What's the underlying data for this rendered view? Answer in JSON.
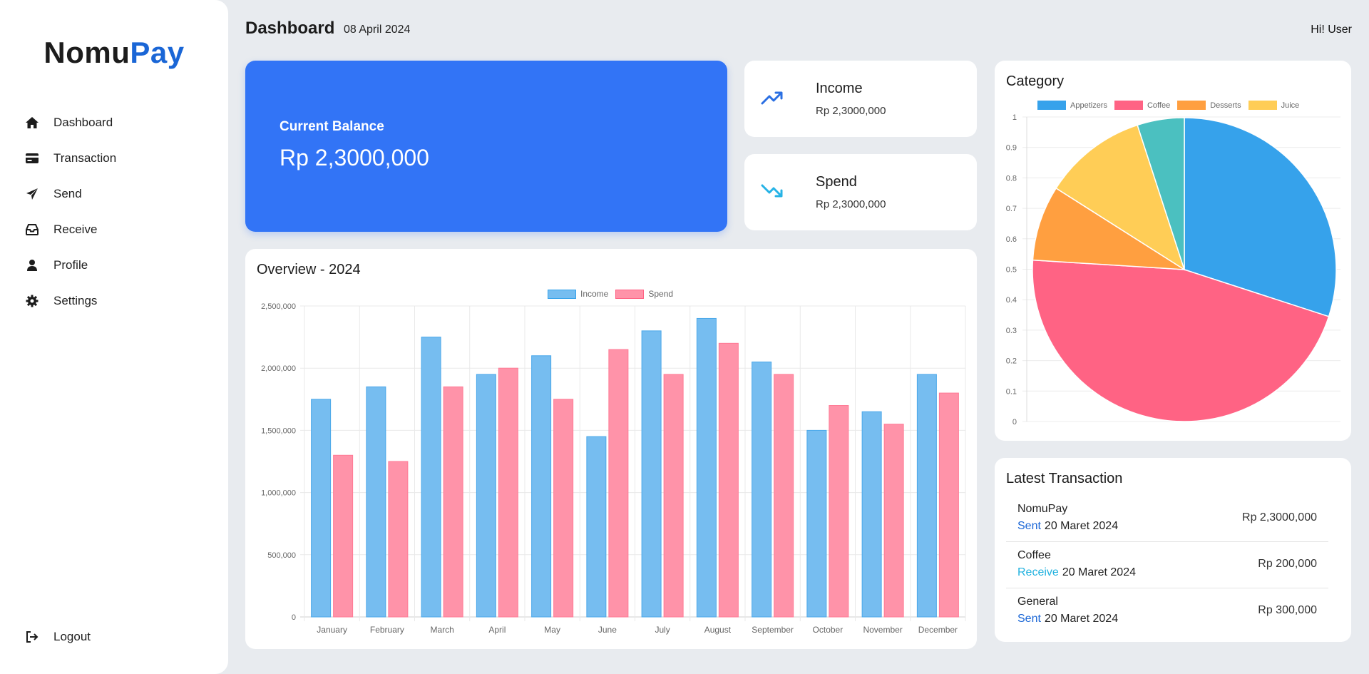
{
  "sidebar": {
    "brand_a": "Nomu",
    "brand_b": "Pay",
    "items": [
      {
        "label": "Dashboard",
        "icon": "home-icon"
      },
      {
        "label": "Transaction",
        "icon": "card-icon"
      },
      {
        "label": "Send",
        "icon": "send-icon"
      },
      {
        "label": "Receive",
        "icon": "inbox-icon"
      },
      {
        "label": "Profile",
        "icon": "user-icon"
      },
      {
        "label": "Settings",
        "icon": "gear-icon"
      }
    ],
    "logout": "Logout"
  },
  "header": {
    "title": "Dashboard",
    "date": "08 April 2024",
    "greeting": "Hi! User"
  },
  "balance": {
    "title": "Current Balance",
    "value": "Rp 2,3000,000"
  },
  "income": {
    "title": "Income",
    "value": "Rp 2,3000,000"
  },
  "spend": {
    "title": "Spend",
    "value": "Rp 2,3000,000"
  },
  "overview": {
    "title": "Overview - 2024"
  },
  "category": {
    "title": "Category"
  },
  "transactions": {
    "title": "Latest Transaction",
    "items": [
      {
        "name": "NomuPay",
        "status": "Sent",
        "date": "20 Maret 2024",
        "amount": "Rp 2,3000,000",
        "status_color": "#1a66d6"
      },
      {
        "name": "Coffee",
        "status": "Receive",
        "date": "20 Maret 2024",
        "amount": "Rp 200,000",
        "status_color": "#22b2df"
      },
      {
        "name": "General",
        "status": "Sent",
        "date": "20 Maret 2024",
        "amount": "Rp 300,000",
        "status_color": "#1a66d6"
      }
    ]
  },
  "colors": {
    "primary": "#3274f6",
    "brand_blue": "#1a66d6",
    "income_bar": "#76bdf0",
    "spend_bar": "#ff93a9"
  },
  "chart_data": [
    {
      "type": "bar",
      "title": "Overview - 2024",
      "categories": [
        "January",
        "February",
        "March",
        "April",
        "May",
        "June",
        "July",
        "August",
        "September",
        "October",
        "November",
        "December"
      ],
      "series": [
        {
          "name": "Income",
          "color": "#76bdf0",
          "values": [
            1750000,
            1850000,
            2250000,
            1950000,
            2100000,
            1450000,
            2300000,
            2400000,
            2050000,
            1500000,
            1650000,
            1950000
          ]
        },
        {
          "name": "Spend",
          "color": "#ff93a9",
          "values": [
            1300000,
            1250000,
            1850000,
            2000000,
            1750000,
            2150000,
            1950000,
            2200000,
            1950000,
            1700000,
            1550000,
            1800000
          ]
        }
      ],
      "ylim": [
        0,
        2500000
      ],
      "yticks": [
        "0",
        "500,000",
        "1,000,000",
        "1,500,000",
        "2,000,000",
        "2,500,000"
      ],
      "legend": "top",
      "grid": true
    },
    {
      "type": "pie",
      "title": "Category",
      "labels": [
        "Appetizers",
        "Coffee",
        "Desserts",
        "Juice",
        ""
      ],
      "values": [
        30,
        46,
        8,
        11,
        5
      ],
      "colors": [
        "#36a2eb",
        "#ff6384",
        "#ff9f40",
        "#ffcd56",
        "#4bc0c0"
      ],
      "yticks": [
        "0",
        "0.1",
        "0.2",
        "0.3",
        "0.4",
        "0.5",
        "0.6",
        "0.7",
        "0.8",
        "0.9",
        "1"
      ],
      "legend": "top",
      "grid": true
    }
  ]
}
